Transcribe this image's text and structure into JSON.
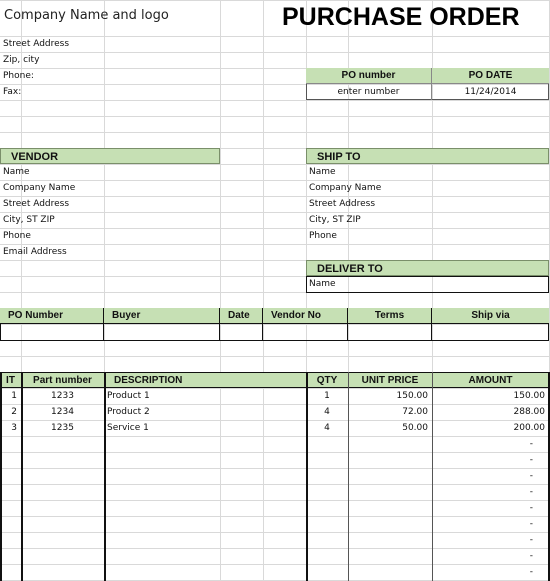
{
  "header": {
    "company": "Company Name  and logo",
    "title": "PURCHASE ORDER"
  },
  "company_info": [
    "Street Address",
    "Zip, city",
    "Phone:",
    "Fax:"
  ],
  "po_box": {
    "number_label": "PO number",
    "date_label": "PO DATE",
    "number_value": "enter number",
    "date_value": "11/24/2014"
  },
  "vendor": {
    "label": "VENDOR",
    "lines": [
      "Name",
      "Company Name",
      "Street Address",
      "City, ST  ZIP",
      "Phone",
      "Email Address"
    ]
  },
  "ship_to": {
    "label": "SHIP TO",
    "lines": [
      "Name",
      "Company Name",
      "Street Address",
      "City, ST  ZIP",
      "Phone"
    ]
  },
  "deliver_to": {
    "label": "DELIVER TO",
    "lines": [
      "Name"
    ]
  },
  "order_info": {
    "columns": [
      "PO Number",
      "Buyer",
      "Date",
      "Vendor No",
      "Terms",
      "Ship via"
    ],
    "values": [
      "",
      "",
      "",
      "",
      "",
      ""
    ]
  },
  "items": {
    "columns": [
      "IT",
      "Part number",
      "DESCRIPTION",
      "QTY",
      "UNIT PRICE",
      "AMOUNT"
    ],
    "rows": [
      {
        "it": "1",
        "part": "1233",
        "desc": "Product 1",
        "qty": "1",
        "price": "150.00",
        "amount": "150.00"
      },
      {
        "it": "2",
        "part": "1234",
        "desc": "Product 2",
        "qty": "4",
        "price": "72.00",
        "amount": "288.00"
      },
      {
        "it": "3",
        "part": "1235",
        "desc": "Service 1",
        "qty": "4",
        "price": "50.00",
        "amount": "200.00"
      }
    ],
    "empty_amount": "-",
    "empty_rows": 9
  },
  "colors": {
    "header_fill": "#c6e0b4",
    "gridline": "#d9d9d9",
    "border": "#111111"
  }
}
